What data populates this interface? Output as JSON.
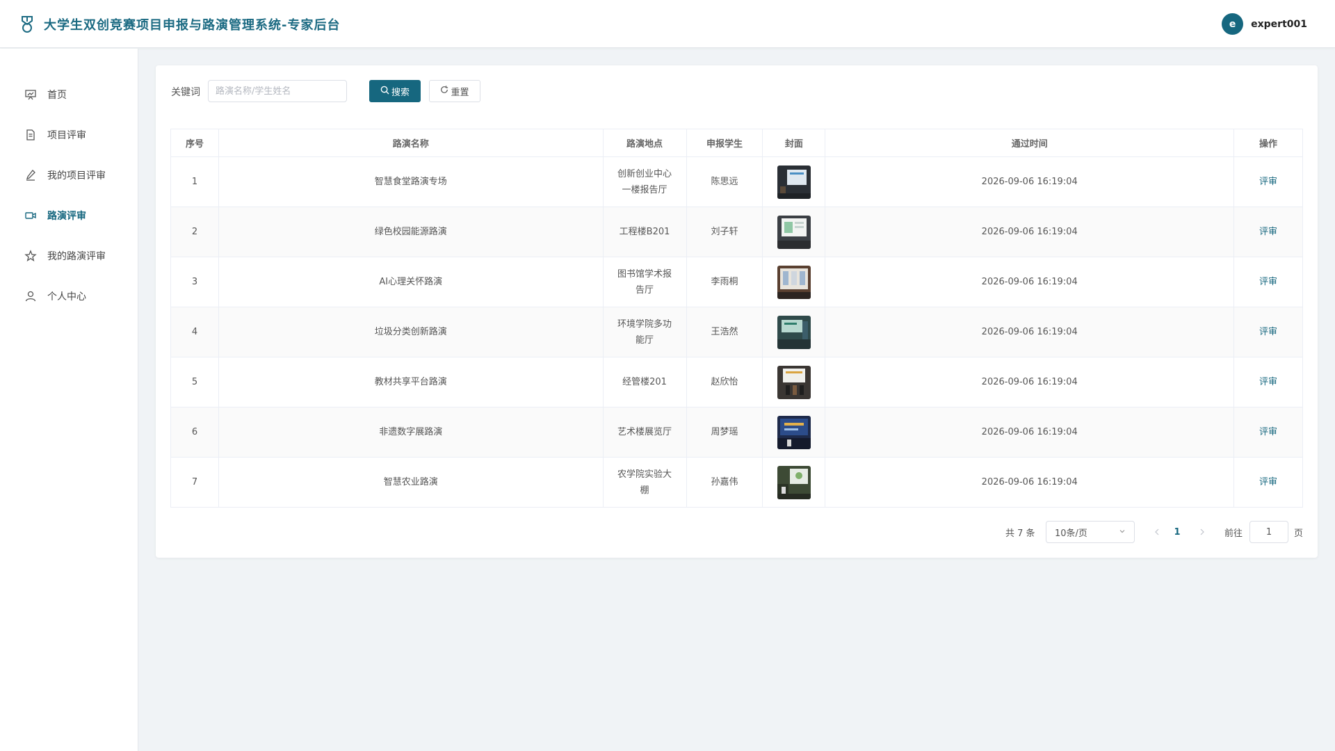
{
  "header": {
    "title": "大学生双创竞赛项目申报与路演管理系统-专家后台",
    "user": {
      "avatar_letter": "e",
      "username": "expert001"
    }
  },
  "sidebar": {
    "items": [
      {
        "label": "首页",
        "icon": "presentation-icon",
        "active": false
      },
      {
        "label": "项目评审",
        "icon": "document-icon",
        "active": false
      },
      {
        "label": "我的项目评审",
        "icon": "pen-icon",
        "active": false
      },
      {
        "label": "路演评审",
        "icon": "video-camera-icon",
        "active": true
      },
      {
        "label": "我的路演评审",
        "icon": "star-icon",
        "active": false
      },
      {
        "label": "个人中心",
        "icon": "user-icon",
        "active": false
      }
    ]
  },
  "search": {
    "label": "关键词",
    "placeholder": "路演名称/学生姓名",
    "value": "",
    "search_button": "搜索",
    "reset_button": "重置"
  },
  "table": {
    "columns": [
      "序号",
      "路演名称",
      "路演地点",
      "申报学生",
      "封面",
      "通过时间",
      "操作"
    ],
    "rows": [
      {
        "index": "1",
        "name": "智慧食堂路演专场",
        "location": "创新创业中心一楼报告厅",
        "student": "陈思远",
        "time": "2026-09-06 16:19:04",
        "action": "评审"
      },
      {
        "index": "2",
        "name": "绿色校园能源路演",
        "location": "工程楼B201",
        "student": "刘子轩",
        "time": "2026-09-06 16:19:04",
        "action": "评审"
      },
      {
        "index": "3",
        "name": "AI心理关怀路演",
        "location": "图书馆学术报告厅",
        "student": "李雨桐",
        "time": "2026-09-06 16:19:04",
        "action": "评审"
      },
      {
        "index": "4",
        "name": "垃圾分类创新路演",
        "location": "环境学院多功能厅",
        "student": "王浩然",
        "time": "2026-09-06 16:19:04",
        "action": "评审"
      },
      {
        "index": "5",
        "name": "教材共享平台路演",
        "location": "经管楼201",
        "student": "赵欣怡",
        "time": "2026-09-06 16:19:04",
        "action": "评审"
      },
      {
        "index": "6",
        "name": "非遗数字展路演",
        "location": "艺术楼展览厅",
        "student": "周梦瑶",
        "time": "2026-09-06 16:19:04",
        "action": "评审"
      },
      {
        "index": "7",
        "name": "智慧农业路演",
        "location": "农学院实验大棚",
        "student": "孙嘉伟",
        "time": "2026-09-06 16:19:04",
        "action": "评审"
      }
    ]
  },
  "pagination": {
    "total_text": "共 7 条",
    "page_size": "10条/页",
    "current_page": "1",
    "goto_label": "前往",
    "goto_value": "1",
    "page_suffix": "页"
  },
  "colors": {
    "accent": "#16677f",
    "background": "#f0f3f6"
  }
}
